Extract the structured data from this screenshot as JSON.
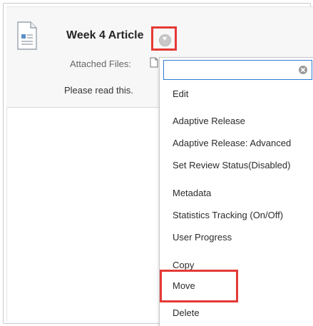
{
  "item": {
    "title": "Week 4 Article",
    "attached_label": "Attached Files:",
    "description": "Please read this."
  },
  "menu": {
    "search_value": "",
    "items": [
      "Edit",
      "Adaptive Release",
      "Adaptive Release: Advanced",
      "Set Review Status(Disabled)",
      "Metadata",
      "Statistics Tracking (On/Off)",
      "User Progress",
      "Copy",
      "Move",
      "Delete"
    ]
  },
  "colors": {
    "highlight": "#e53935",
    "search_border": "#2d7bd4",
    "card_bg": "#f7f7f7"
  },
  "icons": {
    "document": "document-icon",
    "options": "options-chevron-icon",
    "attachment": "file-attachment-icon",
    "clear": "clear-search-icon"
  }
}
